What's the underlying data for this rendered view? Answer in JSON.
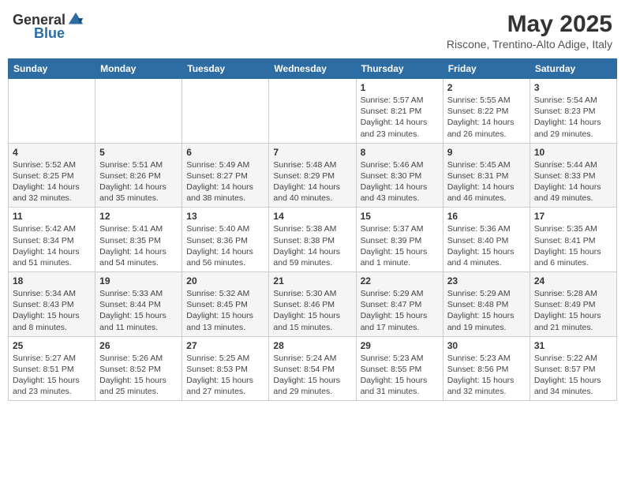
{
  "logo": {
    "general": "General",
    "blue": "Blue"
  },
  "title": "May 2025",
  "location": "Riscone, Trentino-Alto Adige, Italy",
  "days_of_week": [
    "Sunday",
    "Monday",
    "Tuesday",
    "Wednesday",
    "Thursday",
    "Friday",
    "Saturday"
  ],
  "weeks": [
    [
      {
        "day": "",
        "info": ""
      },
      {
        "day": "",
        "info": ""
      },
      {
        "day": "",
        "info": ""
      },
      {
        "day": "",
        "info": ""
      },
      {
        "day": "1",
        "info": "Sunrise: 5:57 AM\nSunset: 8:21 PM\nDaylight: 14 hours\nand 23 minutes."
      },
      {
        "day": "2",
        "info": "Sunrise: 5:55 AM\nSunset: 8:22 PM\nDaylight: 14 hours\nand 26 minutes."
      },
      {
        "day": "3",
        "info": "Sunrise: 5:54 AM\nSunset: 8:23 PM\nDaylight: 14 hours\nand 29 minutes."
      }
    ],
    [
      {
        "day": "4",
        "info": "Sunrise: 5:52 AM\nSunset: 8:25 PM\nDaylight: 14 hours\nand 32 minutes."
      },
      {
        "day": "5",
        "info": "Sunrise: 5:51 AM\nSunset: 8:26 PM\nDaylight: 14 hours\nand 35 minutes."
      },
      {
        "day": "6",
        "info": "Sunrise: 5:49 AM\nSunset: 8:27 PM\nDaylight: 14 hours\nand 38 minutes."
      },
      {
        "day": "7",
        "info": "Sunrise: 5:48 AM\nSunset: 8:29 PM\nDaylight: 14 hours\nand 40 minutes."
      },
      {
        "day": "8",
        "info": "Sunrise: 5:46 AM\nSunset: 8:30 PM\nDaylight: 14 hours\nand 43 minutes."
      },
      {
        "day": "9",
        "info": "Sunrise: 5:45 AM\nSunset: 8:31 PM\nDaylight: 14 hours\nand 46 minutes."
      },
      {
        "day": "10",
        "info": "Sunrise: 5:44 AM\nSunset: 8:33 PM\nDaylight: 14 hours\nand 49 minutes."
      }
    ],
    [
      {
        "day": "11",
        "info": "Sunrise: 5:42 AM\nSunset: 8:34 PM\nDaylight: 14 hours\nand 51 minutes."
      },
      {
        "day": "12",
        "info": "Sunrise: 5:41 AM\nSunset: 8:35 PM\nDaylight: 14 hours\nand 54 minutes."
      },
      {
        "day": "13",
        "info": "Sunrise: 5:40 AM\nSunset: 8:36 PM\nDaylight: 14 hours\nand 56 minutes."
      },
      {
        "day": "14",
        "info": "Sunrise: 5:38 AM\nSunset: 8:38 PM\nDaylight: 14 hours\nand 59 minutes."
      },
      {
        "day": "15",
        "info": "Sunrise: 5:37 AM\nSunset: 8:39 PM\nDaylight: 15 hours\nand 1 minute."
      },
      {
        "day": "16",
        "info": "Sunrise: 5:36 AM\nSunset: 8:40 PM\nDaylight: 15 hours\nand 4 minutes."
      },
      {
        "day": "17",
        "info": "Sunrise: 5:35 AM\nSunset: 8:41 PM\nDaylight: 15 hours\nand 6 minutes."
      }
    ],
    [
      {
        "day": "18",
        "info": "Sunrise: 5:34 AM\nSunset: 8:43 PM\nDaylight: 15 hours\nand 8 minutes."
      },
      {
        "day": "19",
        "info": "Sunrise: 5:33 AM\nSunset: 8:44 PM\nDaylight: 15 hours\nand 11 minutes."
      },
      {
        "day": "20",
        "info": "Sunrise: 5:32 AM\nSunset: 8:45 PM\nDaylight: 15 hours\nand 13 minutes."
      },
      {
        "day": "21",
        "info": "Sunrise: 5:30 AM\nSunset: 8:46 PM\nDaylight: 15 hours\nand 15 minutes."
      },
      {
        "day": "22",
        "info": "Sunrise: 5:29 AM\nSunset: 8:47 PM\nDaylight: 15 hours\nand 17 minutes."
      },
      {
        "day": "23",
        "info": "Sunrise: 5:29 AM\nSunset: 8:48 PM\nDaylight: 15 hours\nand 19 minutes."
      },
      {
        "day": "24",
        "info": "Sunrise: 5:28 AM\nSunset: 8:49 PM\nDaylight: 15 hours\nand 21 minutes."
      }
    ],
    [
      {
        "day": "25",
        "info": "Sunrise: 5:27 AM\nSunset: 8:51 PM\nDaylight: 15 hours\nand 23 minutes."
      },
      {
        "day": "26",
        "info": "Sunrise: 5:26 AM\nSunset: 8:52 PM\nDaylight: 15 hours\nand 25 minutes."
      },
      {
        "day": "27",
        "info": "Sunrise: 5:25 AM\nSunset: 8:53 PM\nDaylight: 15 hours\nand 27 minutes."
      },
      {
        "day": "28",
        "info": "Sunrise: 5:24 AM\nSunset: 8:54 PM\nDaylight: 15 hours\nand 29 minutes."
      },
      {
        "day": "29",
        "info": "Sunrise: 5:23 AM\nSunset: 8:55 PM\nDaylight: 15 hours\nand 31 minutes."
      },
      {
        "day": "30",
        "info": "Sunrise: 5:23 AM\nSunset: 8:56 PM\nDaylight: 15 hours\nand 32 minutes."
      },
      {
        "day": "31",
        "info": "Sunrise: 5:22 AM\nSunset: 8:57 PM\nDaylight: 15 hours\nand 34 minutes."
      }
    ]
  ]
}
